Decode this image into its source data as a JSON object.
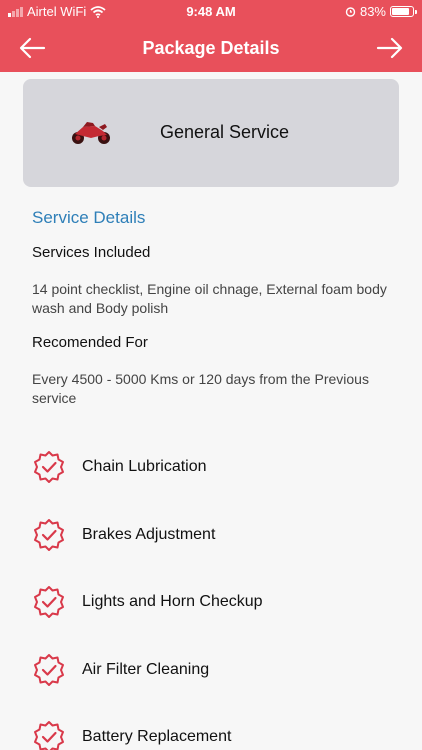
{
  "status_bar": {
    "carrier": "Airtel WiFi",
    "time": "9:48 AM",
    "battery": "83%",
    "battery_level": 0.83
  },
  "navbar": {
    "title": "Package Details",
    "back_icon": "arrow-left-icon",
    "next_icon": "arrow-right-icon"
  },
  "package": {
    "name": "General Service",
    "icon": "motorcycle-icon"
  },
  "details": {
    "section_title": "Service Details",
    "services_label": "Services Included",
    "services_text": "14 point checklist, Engine oil chnage, External foam body wash and Body polish",
    "recommended_label": "Recomended For",
    "recommended_text": "Every 4500 - 5000 Kms or 120 days from the Previous service"
  },
  "features": [
    {
      "label": "Chain Lubrication"
    },
    {
      "label": "Brakes Adjustment"
    },
    {
      "label": "Lights and Horn Checkup"
    },
    {
      "label": "Air Filter Cleaning"
    },
    {
      "label": "Battery Replacement"
    }
  ],
  "colors": {
    "header": "#e8505b",
    "accent_text": "#2e7fb8",
    "check_icon": "#d9394a"
  }
}
